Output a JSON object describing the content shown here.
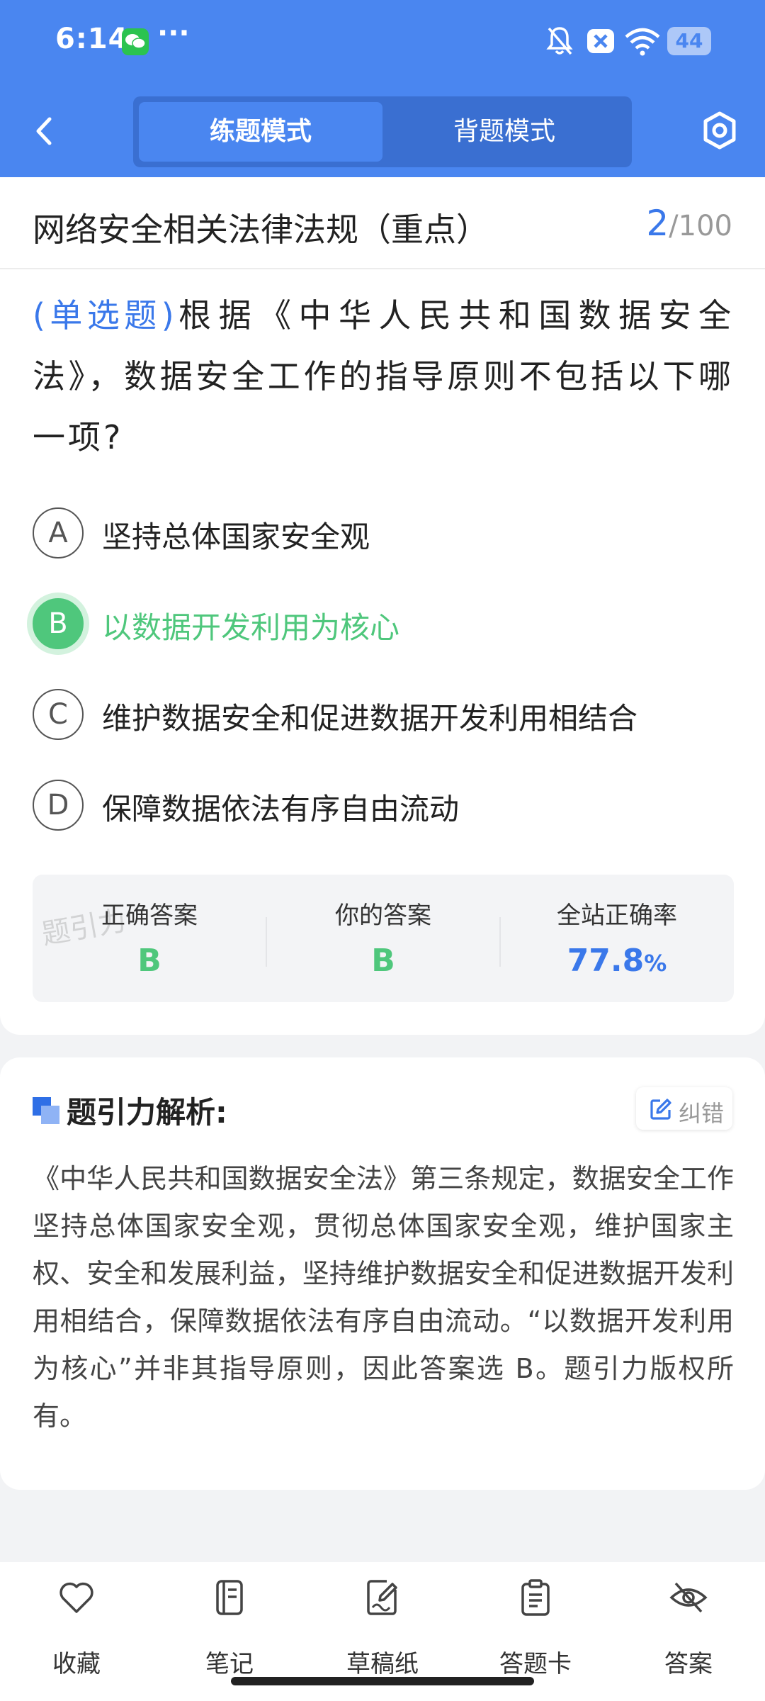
{
  "status_bar": {
    "time": "6:14",
    "dots": "···",
    "battery": "44"
  },
  "header": {
    "tabs": [
      {
        "label": "练题模式",
        "active": true
      },
      {
        "label": "背题模式",
        "active": false
      }
    ]
  },
  "section": {
    "title": "网络安全相关法律法规（重点）",
    "current": "2",
    "separator": "/",
    "total": "100"
  },
  "question": {
    "type": "(单选题)",
    "text": "根据《中华人民共和国数据安全法》，数据安全工作的指导原则不包括以下哪一项?"
  },
  "options": [
    {
      "letter": "A",
      "text": "坚持总体国家安全观",
      "state": "normal"
    },
    {
      "letter": "B",
      "text": "以数据开发利用为核心",
      "state": "correct"
    },
    {
      "letter": "C",
      "text": "维护数据安全和促进数据开发利用相结合",
      "state": "normal"
    },
    {
      "letter": "D",
      "text": "保障数据依法有序自由流动",
      "state": "normal"
    }
  ],
  "stats": {
    "watermark": "题引力",
    "correct_label": "正确答案",
    "correct_value": "B",
    "yours_label": "你的答案",
    "yours_value": "B",
    "rate_label": "全站正确率",
    "rate_value": "77.8",
    "rate_unit": "%"
  },
  "analysis": {
    "title": "题引力解析:",
    "report_label": "纠错",
    "text": "《中华人民共和国数据安全法》第三条规定，数据安全工作坚持总体国家安全观，贯彻总体国家安全观，维护国家主权、安全和发展利益，坚持维护数据安全和促进数据开发利用相结合，保障数据依法有序自由流动。“以数据开发利用为核心”并非其指导原则，因此答案选 B。题引力版权所有。"
  },
  "bottom_nav": [
    {
      "label": "收藏",
      "icon": "heart-icon"
    },
    {
      "label": "笔记",
      "icon": "notebook-icon"
    },
    {
      "label": "草稿纸",
      "icon": "draft-pen-icon"
    },
    {
      "label": "答题卡",
      "icon": "clipboard-icon"
    },
    {
      "label": "答案",
      "icon": "eye-off-icon"
    }
  ],
  "colors": {
    "primary": "#4a86f0",
    "correct": "#4fc77c",
    "accent": "#3a78ea"
  }
}
